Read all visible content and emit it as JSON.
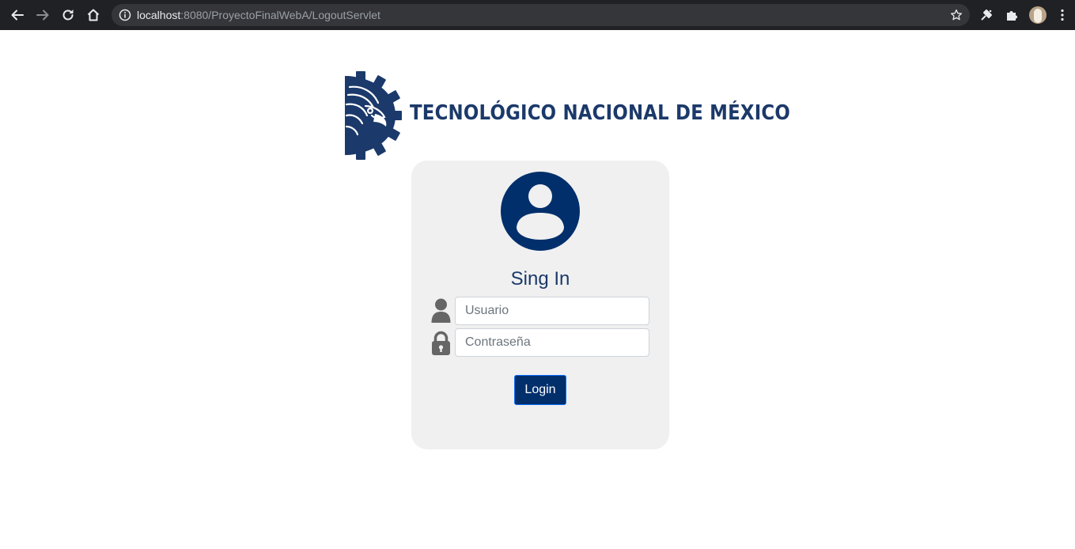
{
  "browser": {
    "url_host": "localhost",
    "url_rest": ":8080/ProyectoFinalWebA/LogoutServlet",
    "icons": [
      "back-icon",
      "forward-icon",
      "reload-icon",
      "home-icon",
      "info-icon",
      "bookmark-star-icon",
      "extension-icon",
      "puzzle-icon",
      "profile-avatar",
      "menu-icon"
    ]
  },
  "logo": {
    "text": "TECNOLÓGICO NACIONAL DE MÉXICO",
    "color": "#1b396a"
  },
  "login": {
    "title": "Sing In",
    "username_placeholder": "Usuario",
    "password_placeholder": "Contraseña",
    "submit_label": "Login",
    "accent_color": "#002f6c"
  }
}
